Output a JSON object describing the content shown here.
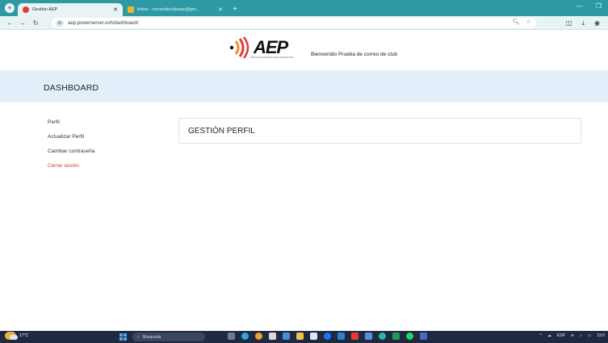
{
  "browser": {
    "tabs": [
      {
        "title": "Gestión AEP",
        "active": true,
        "favicon_color": "#e53935"
      },
      {
        "title": "Inbox - correodeclubaep@gm...",
        "active": false,
        "favicon_color": "#f2b233"
      }
    ],
    "new_tab_label": "+",
    "url": "aep.powerserver.ovh/dashboard/"
  },
  "header": {
    "logo_text": "AEP",
    "logo_subtitle": "ASOCIACION ESPAÑOLA DE POWERLIFTING",
    "welcome_text": "Bienvenido Prueba de correo de club"
  },
  "band": {
    "title": "DASHBOARD"
  },
  "sidebar": {
    "items": [
      {
        "label": "Perfil"
      },
      {
        "label": "Actualizar Perfil"
      },
      {
        "label": "Cambiar contraseña"
      },
      {
        "label": "Cerrar sesión"
      }
    ]
  },
  "main": {
    "card_title": "GESTIÓN PERFIL"
  },
  "taskbar": {
    "temperature": "17°C",
    "search_placeholder": "Búsqueda",
    "language": "ESP",
    "clock": "19:0"
  },
  "colors": {
    "accent_teal": "#2d9aa3",
    "band_bg": "#e2eefa",
    "logout_red": "#d23b2e",
    "logo_red": "#e53935",
    "logo_orange": "#f28c28"
  }
}
